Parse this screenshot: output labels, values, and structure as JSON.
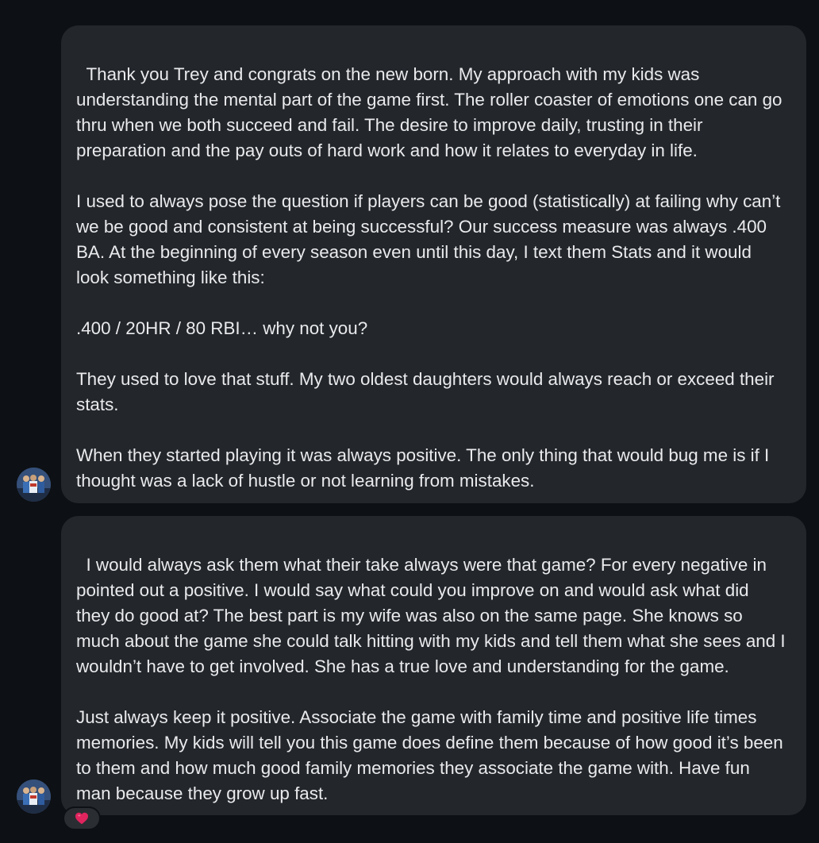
{
  "messages": [
    {
      "text": "Thank you Trey and congrats on the new born. My approach with my kids was understanding the mental part of the game first. The roller coaster of emotions one can go thru when we both succeed and fail. The desire to improve daily, trusting in their preparation and the pay outs of hard work and how it relates to everyday in life.\n\nI used to always pose the question if players can be good (statistically) at failing why can’t we be good and consistent at being successful? Our success measure was always .400 BA. At the beginning of every season even until this day, I text them Stats and it would look something like this:\n\n.400 / 20HR / 80 RBI… why not you?\n\nThey used to love that stuff. My two oldest daughters would always reach or exceed their stats.\n\nWhen they started playing it was always positive. The only thing that would bug me is if I thought was a lack of hustle or not learning from mistakes."
    },
    {
      "text": "I would always ask them what their take always were that game? For every negative in pointed out a positive. I would say what could you improve on and would ask what did they do good at? The best part is my wife was also on the same page. She knows so much about the game she could talk hitting with my kids and tell them what she sees and I wouldn’t have to get involved. She has a true love and understanding for the game.\n\nJust always keep it positive. Associate the game with family time and positive life times memories. My kids will tell you this game does define them because of how good it’s been to them and how much good family memories they associate the game with. Have fun man because they grow up fast."
    }
  ],
  "reaction": {
    "icon": "heart-icon",
    "color": "#e0245e"
  },
  "colors": {
    "background": "#0d1014",
    "bubble": "#23262b",
    "text": "#e9eaec"
  }
}
